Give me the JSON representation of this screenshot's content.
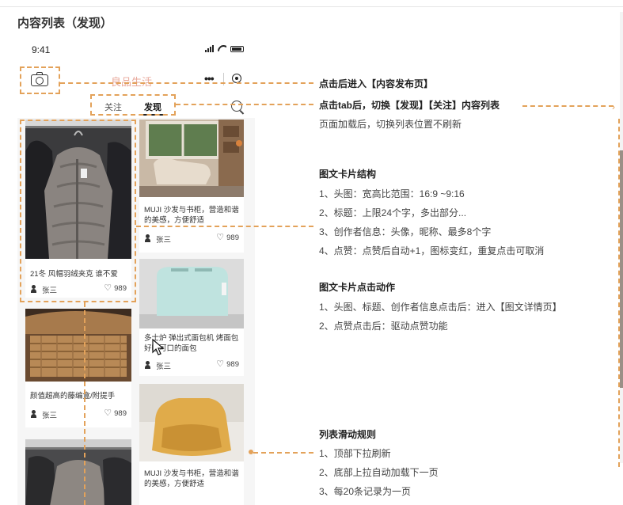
{
  "page": {
    "title": "内容列表（发现）"
  },
  "phone": {
    "status_time": "9:41",
    "app_title": "良品生活",
    "more_label": "•••",
    "tabs": [
      {
        "label": "关注",
        "active": false
      },
      {
        "label": "发现",
        "active": true
      }
    ]
  },
  "feed": {
    "left_column": [
      {
        "caption": "21冬 风帽羽绒夹克 谁不爱",
        "author": "张三",
        "likes": "989",
        "image": "down-jacket-photo"
      },
      {
        "caption": "颜值超高的藤编盒/附提手",
        "author": "张三",
        "likes": "989",
        "image": "rattan-basket-photo"
      },
      {
        "caption": "",
        "author": "",
        "likes": "",
        "image": "coat-rack-photo"
      }
    ],
    "right_column": [
      {
        "caption": "MUJI 沙发与书柜，营造和谐的美感，方便舒适",
        "author": "张三",
        "likes": "989",
        "image": "sofa-room-photo"
      },
      {
        "caption": "多士炉 弹出式面包机 烤面包 好吃可口的面包",
        "author": "张三",
        "likes": "989",
        "image": "toaster-photo"
      },
      {
        "caption": "MUJI 沙发与书柜，营造和谐的美感，方便舒适",
        "author": "",
        "likes": "",
        "image": "beanbag-sofa-photo"
      }
    ]
  },
  "annotations": {
    "camera_note": "点击后进入【内容发布页】",
    "tab_note": "点击tab后，切换【发现】【关注】内容列表",
    "tab_note_sub": "页面加载后，切换列表位置不刷新",
    "card_structure": {
      "heading": "图文卡片结构",
      "items": [
        "1、头图：宽高比范围：16:9 ~9:16",
        "2、标题：上限24个字，多出部分...",
        "3、创作者信息：头像，昵称、最多8个字",
        "4、点赞：点赞后自动+1，图标变红，重复点击可取消"
      ]
    },
    "card_action": {
      "heading": "图文卡片点击动作",
      "items": [
        "1、头图、标题、创作者信息点击后：进入【图文详情页】",
        "2、点赞点击后：驱动点赞功能"
      ]
    },
    "scroll_rules": {
      "heading": "列表滑动规则",
      "items": [
        "1、顶部下拉刷新",
        "2、底部上拉自动加载下一页",
        "3、每20条记录为一页"
      ]
    }
  },
  "colors": {
    "annotation": "#e3a25a",
    "app_title": "#e8a89b",
    "background": "#ffffff"
  }
}
